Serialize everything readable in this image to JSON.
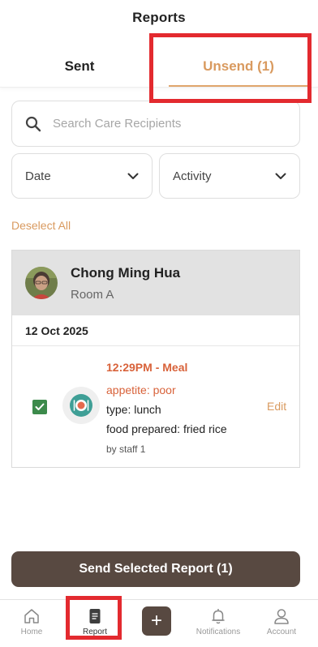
{
  "header": {
    "title": "Reports"
  },
  "tabs": [
    {
      "label": "Sent",
      "active": false
    },
    {
      "label": "Unsend (1)",
      "active": true
    }
  ],
  "search": {
    "placeholder": "Search Care Recipients",
    "value": ""
  },
  "filters": {
    "date_label": "Date",
    "activity_label": "Activity"
  },
  "deselect_label": "Deselect All",
  "recipient": {
    "name": "Chong Ming Hua",
    "room": "Room A",
    "avatar_icon": "avatar-photo"
  },
  "entries_group": {
    "date": "12 Oct 2025",
    "entries": [
      {
        "time_activity": "12:29PM - Meal",
        "appetite": "appetite: poor",
        "type": "type: lunch",
        "food": "food prepared: fried rice",
        "staff": "by staff 1",
        "edit_label": "Edit",
        "checked": true,
        "icon": "meal-icon"
      }
    ]
  },
  "send_button_label": "Send Selected Report (1)",
  "nav": {
    "items": [
      {
        "label": "Home",
        "icon": "home-icon"
      },
      {
        "label": "Report",
        "icon": "report-icon",
        "active": true
      },
      {
        "label": "",
        "icon": "add-icon"
      },
      {
        "label": "Notifications",
        "icon": "bell-icon"
      },
      {
        "label": "Account",
        "icon": "person-icon"
      }
    ]
  },
  "colors": {
    "accent": "#d99a5f",
    "meal_accent": "#d8623a",
    "primary_button": "#584941",
    "highlight": "#e32a2f",
    "check_green": "#3c8a4b"
  }
}
